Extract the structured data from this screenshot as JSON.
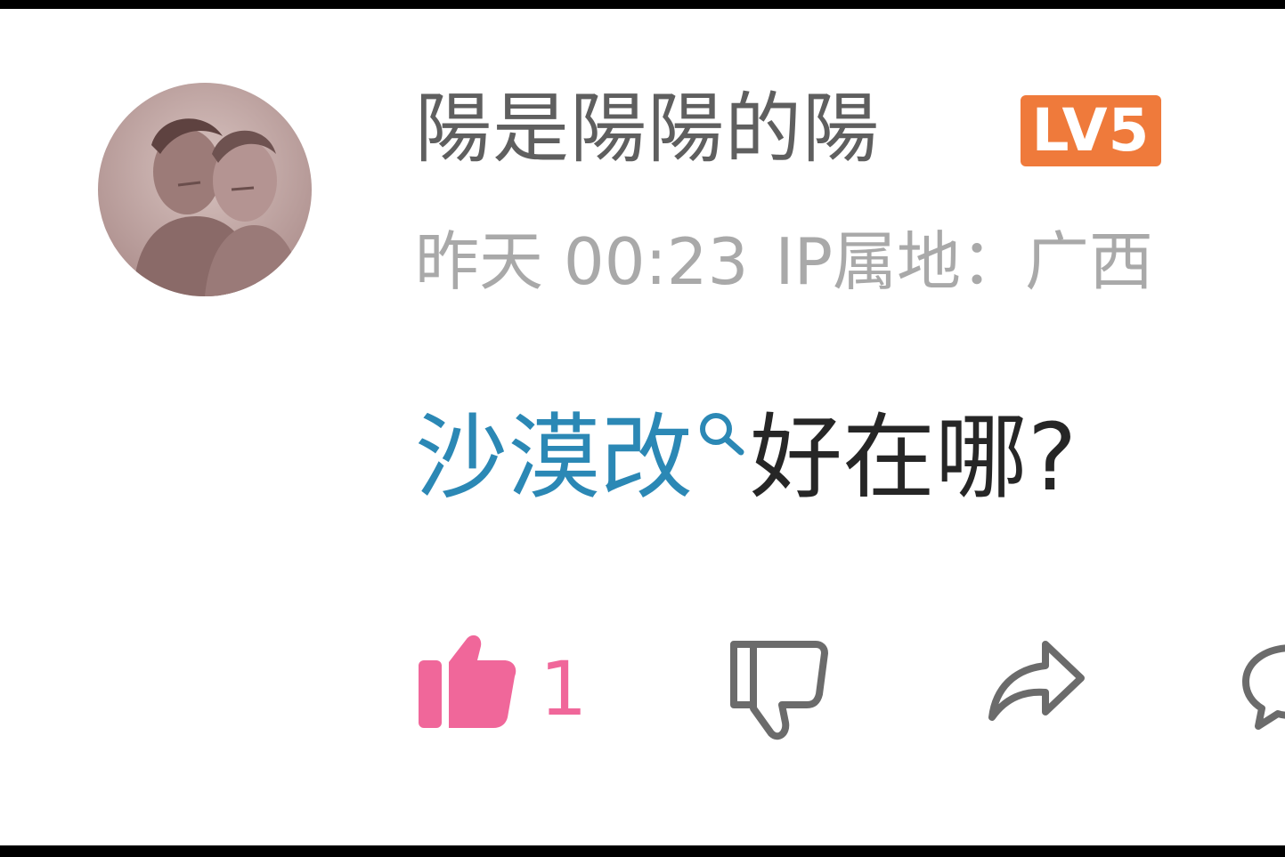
{
  "comment": {
    "user": {
      "name": "陽是陽陽的陽",
      "level_badge": "LV5",
      "avatar": "avatar-photo"
    },
    "meta": {
      "time": "昨天 00:23",
      "ip_location": "IP属地：广西"
    },
    "body": {
      "topic_link": "沙漠改",
      "text": "好在哪?"
    },
    "actions": {
      "like_count": "1",
      "icons": [
        "thumbs-up-icon",
        "thumbs-down-icon",
        "share-icon",
        "comment-icon"
      ]
    }
  },
  "colors": {
    "username": "#5f5f5f",
    "badge": "#ef7a3b",
    "meta": "#a9a9a9",
    "link": "#2b88b5",
    "like": "#f0679a",
    "icon": "#6b6b6b"
  }
}
